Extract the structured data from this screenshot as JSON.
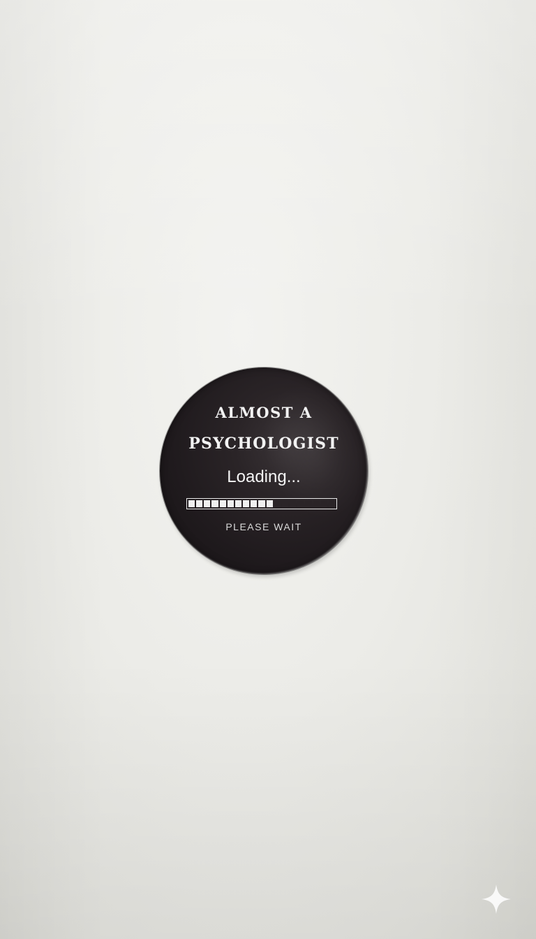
{
  "badge": {
    "line1": "ALMOST A",
    "line2": "PSYCHOLOGIST",
    "loading_text": "Loading...",
    "progress": {
      "filled_segments": 11,
      "total_segments": 19,
      "fraction": 0.58
    },
    "please_wait": "PLEASE WAIT"
  },
  "colors": {
    "background": "#ecece8",
    "badge": "#221d20",
    "text": "#f2f2f2"
  },
  "icons": {
    "corner": "sparkle-icon"
  }
}
